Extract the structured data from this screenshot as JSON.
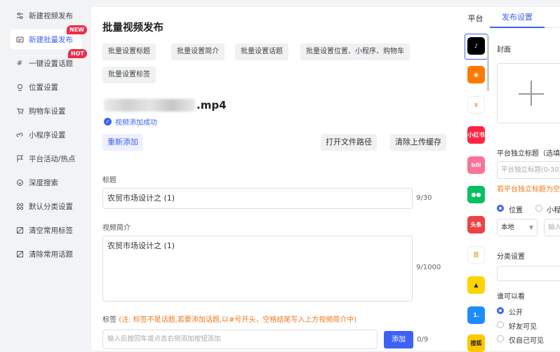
{
  "sidebar": {
    "items": [
      {
        "label": "新建视频发布",
        "icon": "sliders-icon"
      },
      {
        "label": "新建批量发布",
        "icon": "batch-icon",
        "badge": "NEW"
      },
      {
        "label": "一键设置话题",
        "icon": "hash-icon",
        "badge": "HOT"
      },
      {
        "label": "位置设置",
        "icon": "location-pin-icon"
      },
      {
        "label": "购物车设置",
        "icon": "cart-icon"
      },
      {
        "label": "小程序设置",
        "icon": "mini-program-icon"
      },
      {
        "label": "平台活动/热点",
        "icon": "flag-icon"
      },
      {
        "label": "深度搜索",
        "icon": "deep-search-icon"
      },
      {
        "label": "默认分类设置",
        "icon": "grid-icon"
      },
      {
        "label": "清空常用标签",
        "icon": "clear-tag-icon"
      },
      {
        "label": "清除常用话题",
        "icon": "clear-topic-icon"
      }
    ]
  },
  "main": {
    "title": "批量视频发布",
    "batch_buttons": [
      "批量设置标题",
      "批量设置简介",
      "批量设置话题",
      "批量设置位置、小程序、购物车",
      "批量设置标签"
    ],
    "file_ext": ".mp4",
    "upload_status": "视频添加成功",
    "re_add": "重新添加",
    "open_path": "打开文件路径",
    "clear_cache": "清除上传缓存",
    "title_label": "标题",
    "title_value": "农贸市场设计之 (1)",
    "title_counter": "9/30",
    "desc_label": "视频简介",
    "desc_value": "农贸市场设计之 (1)",
    "desc_counter": "9/1000",
    "tag_label": "标签",
    "tag_note": "(注: 标签不是话题,若要添加话题,以#号开头，空格结尾写入上方视频简介中)",
    "tag_placeholder": "输入后按回车或点击右侧添加按钮添加",
    "tag_add": "添加",
    "tag_counter": "0/9"
  },
  "platforms": {
    "title": "平台",
    "items": [
      {
        "name": "douyin-icon",
        "color": "#000000",
        "text": "♪"
      },
      {
        "name": "kuaishou-icon",
        "color": "#ff7a00",
        "text": "◉"
      },
      {
        "name": "channel-icon",
        "color": "#ffffff",
        "text": "ʬ"
      },
      {
        "name": "xiaohongshu-icon",
        "color": "#ff2442",
        "text": "小红书"
      },
      {
        "name": "bilibili-icon",
        "color": "#fb7299",
        "text": "bili"
      },
      {
        "name": "wechat-icon",
        "color": "#07c160",
        "text": "●●"
      },
      {
        "name": "toutiao-icon",
        "color": "#f04142",
        "text": "头条"
      },
      {
        "name": "baijiahao-icon",
        "color": "#ffffff",
        "text": "百"
      },
      {
        "name": "qq-icon",
        "color": "#ffd400",
        "text": "▲"
      },
      {
        "name": "yidian-icon",
        "color": "#1e8bff",
        "text": "1."
      },
      {
        "name": "sohu-icon",
        "color": "#ffc800",
        "text": "搜狐"
      }
    ]
  },
  "right": {
    "tab": "发布设置",
    "cover_label": "封面",
    "independent_title_label": "平台独立标题（选填）",
    "independent_title_placeholder": "平台独立标题(0-30)",
    "independent_hint": "若平台独立标题为空",
    "location_option": "位置",
    "miniprogram_option": "小程序",
    "location_select": "本地",
    "location_input_placeholder": "输入",
    "category_label": "分类设置",
    "visibility_label": "谁可以看",
    "visibility_options": [
      "公开",
      "好友可见",
      "仅自己可见"
    ],
    "accent": "#3d62f5",
    "warning": "#f0781e"
  }
}
